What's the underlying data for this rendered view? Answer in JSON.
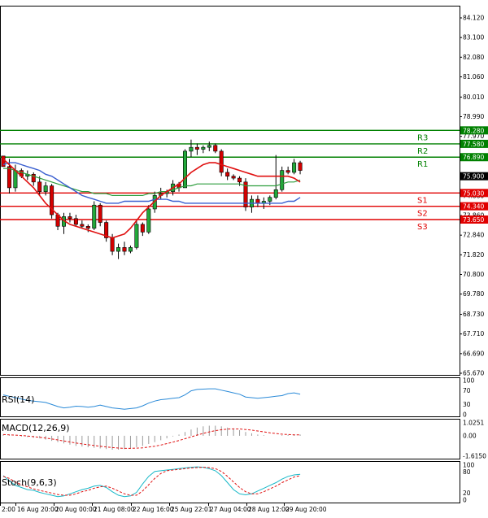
{
  "chart_data": {
    "type": "candlestick",
    "price_axis": {
      "min": 65.67,
      "max": 84.12,
      "ticks": [
        "84.120",
        "83.100",
        "82.080",
        "81.060",
        "80.010",
        "78.990",
        "77.970",
        "76.950",
        "75.900",
        "74.880",
        "73.860",
        "72.840",
        "71.820",
        "70.800",
        "69.780",
        "68.730",
        "67.710",
        "66.690",
        "65.670"
      ]
    },
    "last_price": "75.900",
    "levels": [
      {
        "name": "R3",
        "value": 78.28,
        "label": "78.280",
        "color": "#008000"
      },
      {
        "name": "R2",
        "value": 77.58,
        "label": "77.580",
        "color": "#008000"
      },
      {
        "name": "R1",
        "value": 76.89,
        "label": "76.890",
        "color": "#008000"
      },
      {
        "name": "S1",
        "value": 75.03,
        "label": "75.030",
        "color": "#e00000"
      },
      {
        "name": "S2",
        "value": 74.34,
        "label": "74.340",
        "color": "#e00000"
      },
      {
        "name": "S3",
        "value": 73.65,
        "label": "73.650",
        "color": "#e00000"
      }
    ],
    "x_labels": [
      "2:00",
      "16 Aug 20:00",
      "20 Aug 00:00",
      "21 Aug 08:00",
      "22 Aug 16:00",
      "25 Aug 22:01",
      "27 Aug 04:00",
      "28 Aug 12:00",
      "29 Aug 20:00"
    ],
    "candles": [
      [
        76.95,
        76.9,
        76.4,
        76.4
      ],
      [
        76.4,
        76.8,
        75.0,
        75.3
      ],
      [
        75.3,
        76.5,
        75.1,
        76.2
      ],
      [
        76.2,
        76.3,
        75.8,
        75.9
      ],
      [
        75.9,
        76.2,
        75.7,
        76.0
      ],
      [
        76.0,
        76.1,
        75.4,
        75.6
      ],
      [
        75.6,
        75.9,
        74.9,
        75.1
      ],
      [
        75.1,
        75.6,
        74.9,
        75.4
      ],
      [
        75.4,
        75.5,
        73.7,
        73.9
      ],
      [
        73.9,
        74.0,
        73.1,
        73.3
      ],
      [
        73.3,
        74.0,
        72.9,
        73.8
      ],
      [
        73.8,
        74.0,
        73.5,
        73.7
      ],
      [
        73.7,
        73.9,
        73.3,
        73.4
      ],
      [
        73.4,
        73.6,
        73.2,
        73.3
      ],
      [
        73.3,
        73.4,
        73.0,
        73.2
      ],
      [
        73.2,
        74.6,
        73.1,
        74.4
      ],
      [
        74.4,
        74.5,
        73.3,
        73.5
      ],
      [
        73.5,
        73.6,
        72.5,
        72.7
      ],
      [
        72.7,
        72.9,
        71.8,
        72.0
      ],
      [
        72.0,
        72.4,
        71.6,
        72.2
      ],
      [
        72.2,
        72.5,
        71.8,
        72.0
      ],
      [
        72.0,
        72.3,
        71.9,
        72.2
      ],
      [
        72.2,
        73.6,
        72.1,
        73.4
      ],
      [
        73.4,
        73.5,
        72.8,
        73.0
      ],
      [
        73.0,
        74.4,
        72.9,
        74.2
      ],
      [
        74.2,
        75.1,
        74.0,
        74.9
      ],
      [
        74.9,
        75.3,
        74.7,
        75.0
      ],
      [
        75.0,
        75.2,
        74.8,
        75.1
      ],
      [
        75.1,
        75.7,
        74.9,
        75.5
      ],
      [
        75.5,
        75.6,
        75.1,
        75.3
      ],
      [
        75.3,
        77.3,
        75.3,
        77.2
      ],
      [
        77.2,
        77.8,
        76.9,
        77.4
      ],
      [
        77.4,
        77.6,
        77.0,
        77.3
      ],
      [
        77.3,
        77.5,
        77.1,
        77.4
      ],
      [
        77.4,
        77.7,
        77.2,
        77.5
      ],
      [
        77.5,
        77.6,
        77.1,
        77.2
      ],
      [
        77.2,
        77.3,
        75.9,
        76.1
      ],
      [
        76.1,
        76.3,
        75.7,
        75.9
      ],
      [
        75.9,
        76.0,
        75.7,
        75.8
      ],
      [
        75.8,
        75.9,
        75.4,
        75.6
      ],
      [
        75.6,
        75.8,
        74.1,
        74.3
      ],
      [
        74.3,
        74.9,
        74.0,
        74.7
      ],
      [
        74.7,
        74.9,
        74.3,
        74.5
      ],
      [
        74.5,
        74.8,
        74.2,
        74.6
      ],
      [
        74.6,
        74.9,
        74.4,
        74.8
      ],
      [
        74.8,
        77.0,
        74.7,
        75.2
      ],
      [
        75.2,
        76.4,
        75.1,
        76.2
      ],
      [
        76.2,
        76.4,
        76.0,
        76.1
      ],
      [
        76.1,
        76.8,
        76.0,
        76.6
      ],
      [
        76.6,
        76.7,
        76.0,
        76.2
      ]
    ],
    "ma_red": [
      76.8,
      76.5,
      76.2,
      75.9,
      75.6,
      75.3,
      74.9,
      74.5,
      74.2,
      73.9,
      73.6,
      73.4,
      73.3,
      73.2,
      73.1,
      73.0,
      72.9,
      72.8,
      72.7,
      72.8,
      72.9,
      73.2,
      73.6,
      74.0,
      74.3,
      74.6,
      74.9,
      75.1,
      75.3,
      75.5,
      75.8,
      76.1,
      76.3,
      76.5,
      76.6,
      76.6,
      76.5,
      76.4,
      76.3,
      76.2,
      76.1,
      76.0,
      75.9,
      75.9,
      75.9,
      75.9,
      75.9,
      75.9,
      75.8,
      75.6
    ],
    "ma_blue": [
      76.5,
      76.6,
      76.6,
      76.5,
      76.4,
      76.3,
      76.2,
      76.0,
      75.9,
      75.7,
      75.5,
      75.3,
      75.1,
      74.9,
      74.8,
      74.7,
      74.6,
      74.5,
      74.5,
      74.5,
      74.6,
      74.6,
      74.6,
      74.6,
      74.6,
      74.7,
      74.7,
      74.7,
      74.6,
      74.6,
      74.5,
      74.5,
      74.5,
      74.5,
      74.5,
      74.5,
      74.5,
      74.5,
      74.5,
      74.5,
      74.5,
      74.5,
      74.5,
      74.5,
      74.5,
      74.5,
      74.5,
      74.6,
      74.6,
      74.8
    ],
    "ma_green": [
      76.3,
      76.3,
      76.2,
      76.1,
      76.0,
      75.9,
      75.8,
      75.7,
      75.6,
      75.5,
      75.4,
      75.3,
      75.2,
      75.1,
      75.1,
      75.0,
      75.0,
      75.0,
      74.9,
      74.9,
      74.9,
      74.9,
      74.9,
      74.9,
      75.0,
      75.0,
      75.1,
      75.1,
      75.2,
      75.3,
      75.4,
      75.4,
      75.5,
      75.5,
      75.5,
      75.5,
      75.5,
      75.5,
      75.5,
      75.5,
      75.4,
      75.4,
      75.4,
      75.4,
      75.4,
      75.4,
      75.5,
      75.6,
      75.6,
      75.7
    ],
    "rsi": {
      "label": "RSI(14)",
      "axis": [
        "100",
        "70",
        "30",
        "0"
      ],
      "values": [
        58,
        54,
        50,
        46,
        42,
        40,
        38,
        36,
        30,
        24,
        20,
        22,
        25,
        24,
        22,
        24,
        28,
        24,
        20,
        18,
        16,
        18,
        20,
        26,
        34,
        40,
        44,
        46,
        48,
        50,
        58,
        70,
        74,
        75,
        76,
        76,
        72,
        68,
        64,
        60,
        52,
        50,
        48,
        50,
        52,
        54,
        56,
        62,
        64,
        60
      ]
    },
    "macd": {
      "label": "MACD(12,26,9)",
      "axis": [
        "1.0251",
        "0.00",
        "-1.6150"
      ],
      "histogram": [
        0.1,
        0.05,
        0.0,
        -0.05,
        -0.1,
        -0.15,
        -0.2,
        -0.3,
        -0.4,
        -0.5,
        -0.6,
        -0.7,
        -0.8,
        -0.85,
        -0.9,
        -0.95,
        -1.0,
        -1.05,
        -1.1,
        -1.1,
        -1.05,
        -1.0,
        -0.9,
        -0.8,
        -0.65,
        -0.5,
        -0.35,
        -0.2,
        -0.05,
        0.1,
        0.3,
        0.5,
        0.65,
        0.75,
        0.8,
        0.8,
        0.75,
        0.65,
        0.55,
        0.45,
        0.3,
        0.2,
        0.1,
        0.05,
        0.0,
        0.0,
        0.05,
        0.08,
        0.1,
        0.1
      ],
      "signal": [
        0.1,
        0.08,
        0.05,
        0.02,
        -0.02,
        -0.07,
        -0.12,
        -0.18,
        -0.25,
        -0.33,
        -0.41,
        -0.49,
        -0.57,
        -0.64,
        -0.71,
        -0.77,
        -0.83,
        -0.88,
        -0.93,
        -0.97,
        -0.99,
        -1.0,
        -0.98,
        -0.95,
        -0.89,
        -0.82,
        -0.73,
        -0.62,
        -0.5,
        -0.37,
        -0.23,
        -0.08,
        0.06,
        0.19,
        0.31,
        0.41,
        0.48,
        0.53,
        0.55,
        0.54,
        0.5,
        0.45,
        0.38,
        0.31,
        0.24,
        0.18,
        0.13,
        0.1,
        0.08,
        0.07
      ]
    },
    "stoch": {
      "label": "Stoch(9,6,3)",
      "axis": [
        "100",
        "80",
        "20",
        "0"
      ],
      "k": [
        70,
        55,
        42,
        36,
        30,
        28,
        22,
        18,
        14,
        10,
        12,
        18,
        24,
        30,
        34,
        40,
        42,
        36,
        24,
        14,
        10,
        12,
        22,
        46,
        68,
        82,
        84,
        86,
        88,
        90,
        92,
        94,
        95,
        94,
        90,
        84,
        70,
        50,
        30,
        18,
        15,
        18,
        26,
        34,
        42,
        50,
        60,
        68,
        72,
        74
      ],
      "d": [
        68,
        62,
        52,
        44,
        38,
        32,
        28,
        24,
        20,
        16,
        14,
        14,
        18,
        24,
        28,
        34,
        38,
        40,
        34,
        26,
        18,
        14,
        14,
        26,
        44,
        62,
        76,
        84,
        86,
        88,
        90,
        92,
        93,
        94,
        93,
        90,
        82,
        68,
        52,
        36,
        24,
        18,
        18,
        24,
        32,
        40,
        50,
        58,
        66,
        70
      ]
    }
  }
}
